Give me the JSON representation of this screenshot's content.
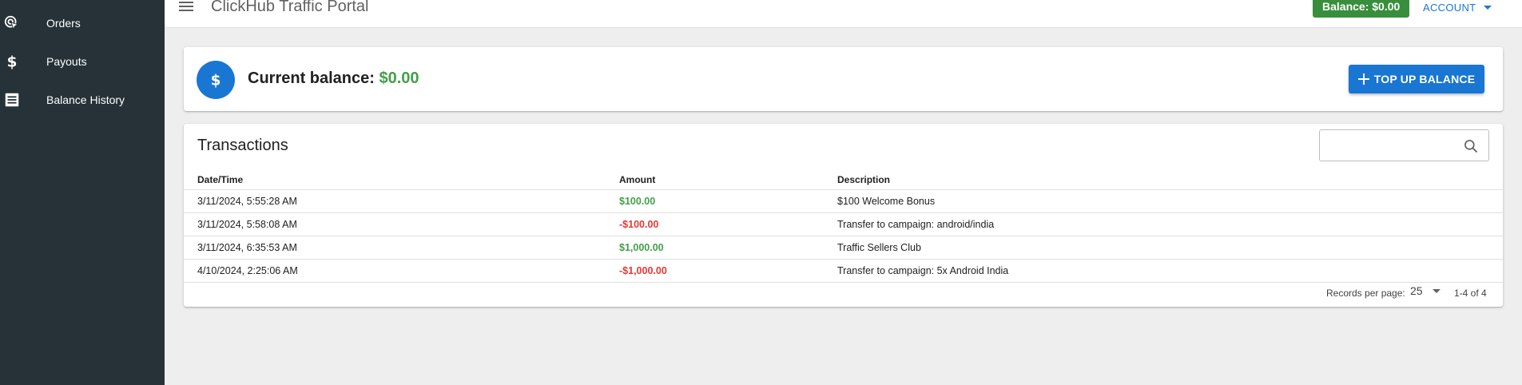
{
  "sidebar": {
    "items": [
      {
        "label": "Orders",
        "icon": "cursor-click-icon"
      },
      {
        "label": "Payouts",
        "icon": "dollar-icon"
      },
      {
        "label": "Balance History",
        "icon": "list-icon"
      }
    ]
  },
  "header": {
    "title": "ClickHub Traffic Portal",
    "balance_label": "Balance: $0.00",
    "account_label": "ACCOUNT"
  },
  "balance_card": {
    "label": "Current balance:",
    "amount": "$0.00",
    "topup_label": "TOP UP BALANCE"
  },
  "transactions": {
    "title": "Transactions",
    "search_placeholder": "",
    "columns": [
      "Date/Time",
      "Amount",
      "Description"
    ],
    "rows": [
      {
        "datetime": "3/11/2024, 5:55:28 AM",
        "amount": "$100.00",
        "description": "$100 Welcome Bonus"
      },
      {
        "datetime": "3/11/2024, 5:58:08 AM",
        "amount": "-$100.00",
        "description": "Transfer to campaign: android/india"
      },
      {
        "datetime": "3/11/2024, 6:35:53 AM",
        "amount": "$1,000.00",
        "description": "Traffic Sellers Club"
      },
      {
        "datetime": "4/10/2024, 2:25:06 AM",
        "amount": "-$1,000.00",
        "description": "Transfer to campaign: 5x Android India"
      }
    ],
    "records_per_page_label": "Records per page:",
    "records_per_page": "25",
    "pagination": "1-4 of 4"
  },
  "colors": {
    "sidebar_bg": "#263238",
    "accent": "#1976d2",
    "positive": "#43a047",
    "negative": "#e53935",
    "balance_button": "#388e3c"
  }
}
